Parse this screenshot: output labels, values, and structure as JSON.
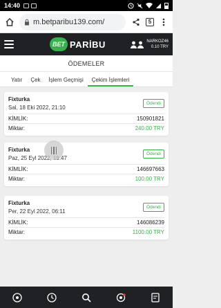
{
  "status_bar": {
    "time": "14:40",
    "battery_percent": 50
  },
  "browser": {
    "url": "m.betparibu139.com/",
    "tab_count": "5"
  },
  "site_header": {
    "logo_badge": "BET",
    "logo_word": "PARİBU",
    "username": "NARKOZ46",
    "balance": "0.10 TRY"
  },
  "page": {
    "title": "ÖDEMELER"
  },
  "tabs": [
    {
      "label": "Yatır"
    },
    {
      "label": "Çek"
    },
    {
      "label": "İşlem Geçmişi"
    },
    {
      "label": "Çekim İşlemleri",
      "active": true
    }
  ],
  "transactions": [
    {
      "method": "Fixturka",
      "date": "Sal, 18 Eki 2022, 21:10",
      "status": "Ödendi",
      "id_label": "KİMLİK:",
      "id": "150901821",
      "amount_label": "Miktar:",
      "amount": "240.00 TRY"
    },
    {
      "method": "Fixturka",
      "date": "Paz, 25 Eyl 2022, 19:47",
      "status": "Ödendi",
      "id_label": "KİMLİK:",
      "id": "146697663",
      "amount_label": "Miktar:",
      "amount": "100.00 TRY"
    },
    {
      "method": "Fixturka",
      "date": "Per, 22 Eyl 2022, 06:11",
      "status": "Ödendi",
      "id_label": "KİMLİK:",
      "id": "146086239",
      "amount_label": "Miktar:",
      "amount": "1100.00 TRY"
    }
  ],
  "colors": {
    "brand_green": "#36b24a",
    "header_dark": "#1f2124"
  },
  "bottom_nav_icons": [
    "sports-ball-icon",
    "clock-icon",
    "search-icon",
    "live-icon",
    "betslip-icon"
  ]
}
